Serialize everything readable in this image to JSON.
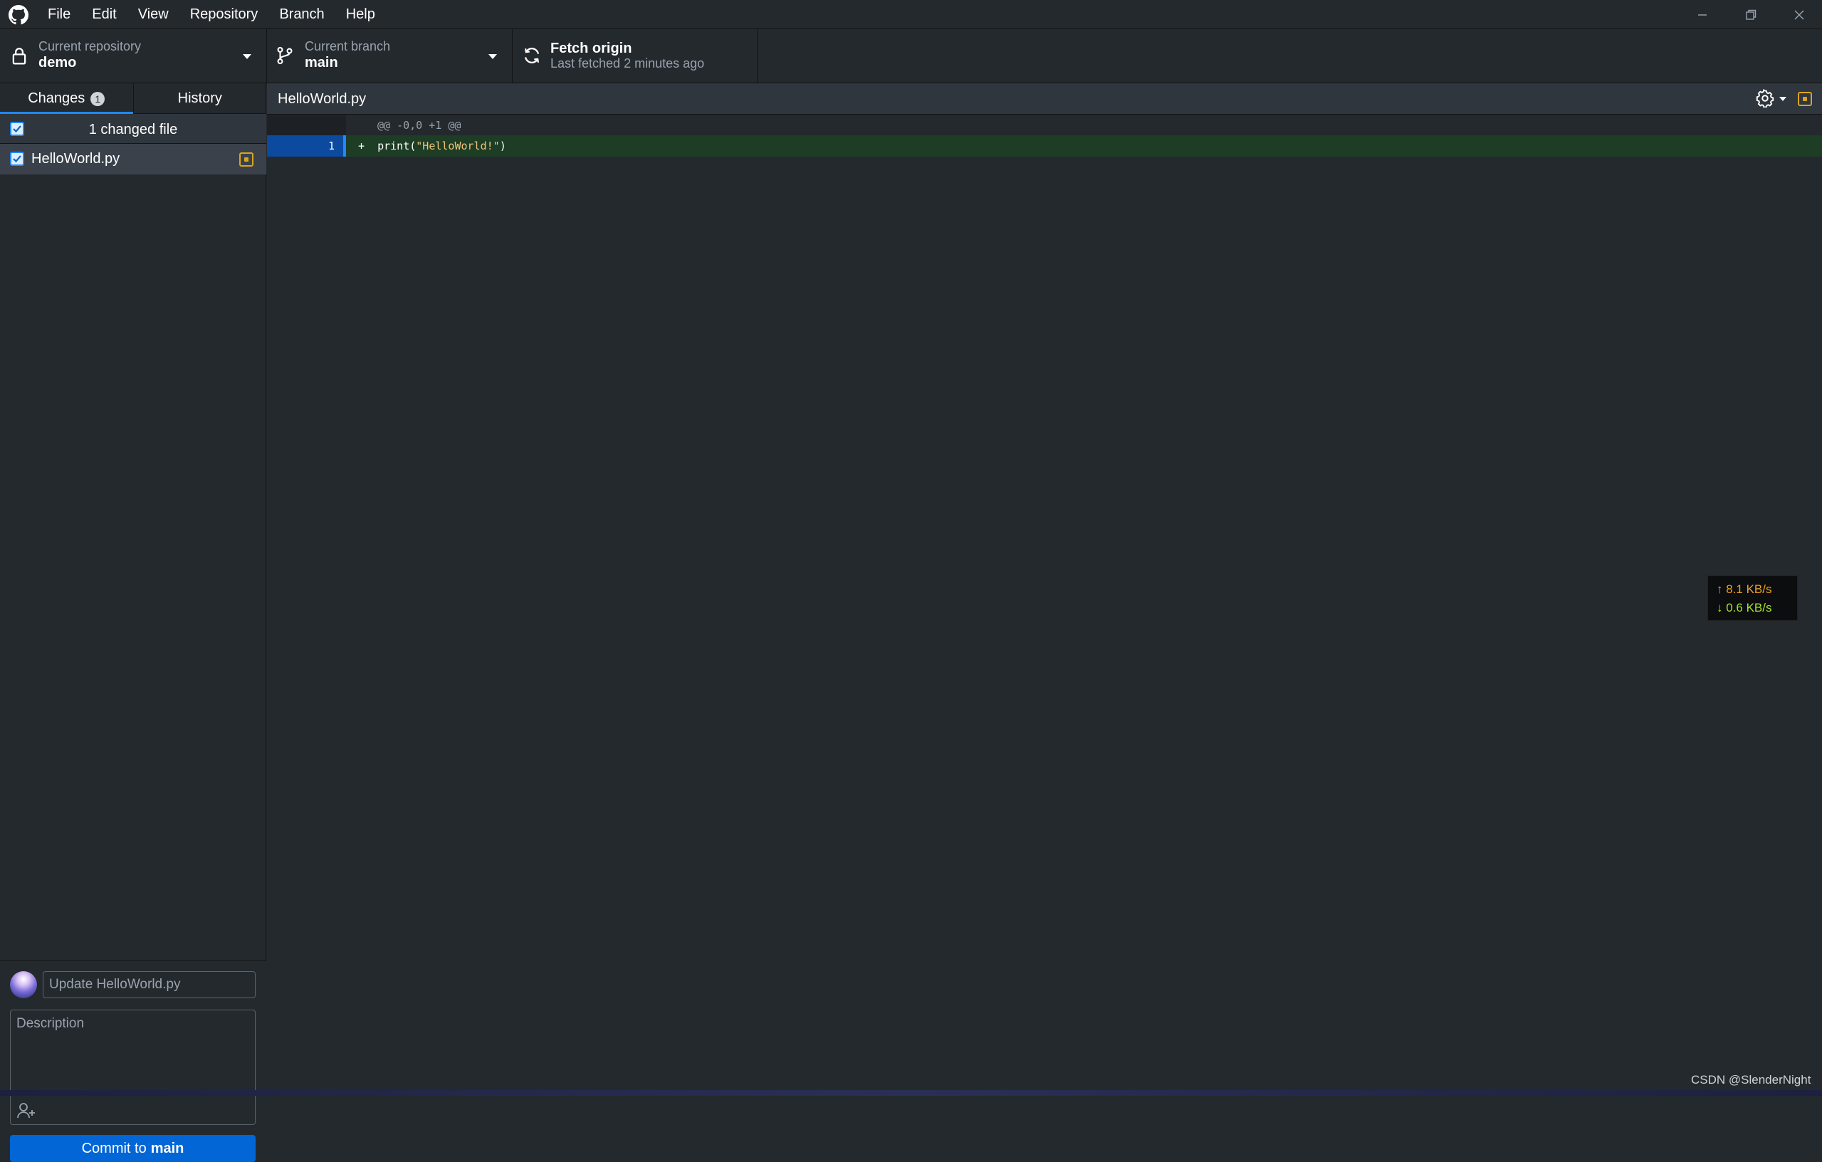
{
  "menu": [
    "File",
    "Edit",
    "View",
    "Repository",
    "Branch",
    "Help"
  ],
  "toolbar": {
    "repo_label": "Current repository",
    "repo_value": "demo",
    "branch_label": "Current branch",
    "branch_value": "main",
    "fetch_title": "Fetch origin",
    "fetch_sub": "Last fetched 2 minutes ago"
  },
  "tabs": {
    "changes_label": "Changes",
    "changes_count": "1",
    "history_label": "History"
  },
  "changes": {
    "header": "1 changed file",
    "files": [
      {
        "name": "HelloWorld.py",
        "status": "modified",
        "checked": true
      }
    ]
  },
  "commit": {
    "summary_placeholder": "Update HelloWorld.py",
    "description_placeholder": "Description",
    "button_prefix": "Commit to",
    "button_branch": "main"
  },
  "diff": {
    "file": "HelloWorld.py",
    "hunk_header": "@@ -0,0 +1 @@",
    "lines": [
      {
        "new_line": "1",
        "marker": "+",
        "code_before": "print(",
        "code_string": "\"HelloWorld!\"",
        "code_after": ")"
      }
    ]
  },
  "network": {
    "upload": "↑ 8.1 KB/s",
    "download": "↓ 0.6 KB/s"
  },
  "watermark": "CSDN @SlenderNight",
  "colors": {
    "background": "#24292e",
    "accent": "#2188ff",
    "commit_button": "#0366d6",
    "modified_status": "#d8a521",
    "added_line_bg": "#1d3d24"
  },
  "icons": {
    "app": "github-logo-icon",
    "repo": "lock-icon",
    "branch": "git-branch-icon",
    "fetch": "sync-icon",
    "settings": "gear-icon",
    "coauthor": "person-add-icon"
  }
}
